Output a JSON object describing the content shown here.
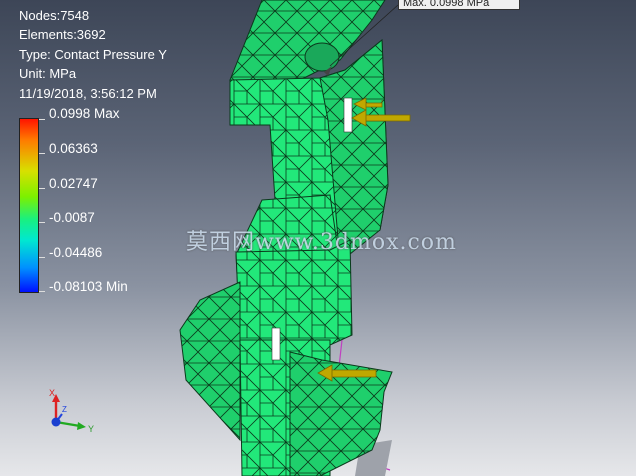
{
  "info": {
    "nodes": "Nodes:7548",
    "elements": "Elements:3692",
    "type": "Type: Contact Pressure Y",
    "unit": "Unit: MPa",
    "timestamp": "11/19/2018, 3:56:12 PM"
  },
  "legend": {
    "ticks": [
      "0.0998 Max",
      "0.06363",
      "0.02747",
      "-0.0087",
      "-0.04486",
      "-0.08103 Min"
    ],
    "colors": {
      "max": "#ff1400",
      "mid": "#19f080",
      "min": "#0010ff"
    }
  },
  "probe": {
    "label": "Max. 0.0998 MPa"
  },
  "watermark": "莫西网www.3dmox.com",
  "triad": {
    "x": "X",
    "y": "Y",
    "z": "Z"
  },
  "mesh_color": "#22e87a",
  "arrow_color": "#b8a000"
}
